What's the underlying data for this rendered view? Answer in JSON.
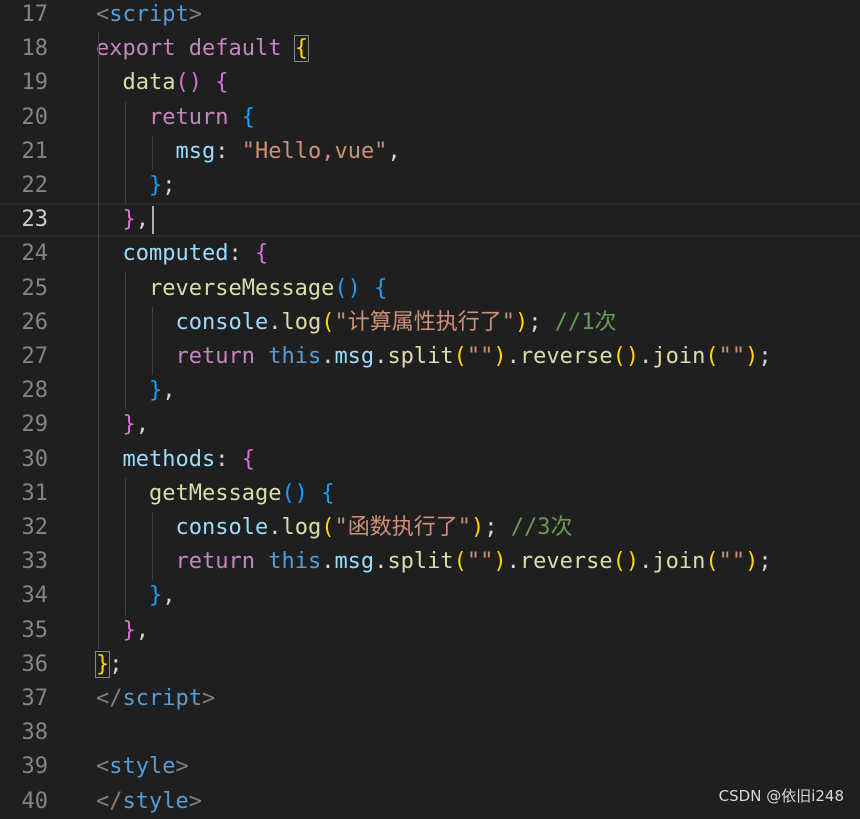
{
  "editor": {
    "lines": [
      {
        "num": "17",
        "tokens": [
          {
            "t": "<",
            "c": "tag-br"
          },
          {
            "t": "script",
            "c": "tag"
          },
          {
            "t": ">",
            "c": "tag-br"
          }
        ]
      },
      {
        "num": "18",
        "tokens": [
          {
            "t": "export ",
            "c": "kw"
          },
          {
            "t": "default ",
            "c": "kw"
          },
          {
            "t": "{",
            "c": "b1 match"
          }
        ]
      },
      {
        "num": "19",
        "tokens": [
          {
            "t": "  "
          },
          {
            "t": "data",
            "c": "fn"
          },
          {
            "t": "()",
            "c": "b2"
          },
          {
            "t": " "
          },
          {
            "t": "{",
            "c": "b2"
          }
        ]
      },
      {
        "num": "20",
        "tokens": [
          {
            "t": "    "
          },
          {
            "t": "return ",
            "c": "kw"
          },
          {
            "t": "{",
            "c": "b3"
          }
        ]
      },
      {
        "num": "21",
        "tokens": [
          {
            "t": "      "
          },
          {
            "t": "msg",
            "c": "prop"
          },
          {
            "t": ": ",
            "c": "punc"
          },
          {
            "t": "\"Hello,vue\"",
            "c": "str"
          },
          {
            "t": ",",
            "c": "punc"
          }
        ]
      },
      {
        "num": "22",
        "tokens": [
          {
            "t": "    "
          },
          {
            "t": "}",
            "c": "b3"
          },
          {
            "t": ";",
            "c": "punc"
          }
        ]
      },
      {
        "num": "23",
        "tokens": [
          {
            "t": "  "
          },
          {
            "t": "}",
            "c": "b2"
          },
          {
            "t": ",",
            "c": "punc"
          }
        ],
        "current": true
      },
      {
        "num": "24",
        "tokens": [
          {
            "t": "  "
          },
          {
            "t": "computed",
            "c": "prop"
          },
          {
            "t": ": ",
            "c": "punc"
          },
          {
            "t": "{",
            "c": "b2"
          }
        ]
      },
      {
        "num": "25",
        "tokens": [
          {
            "t": "    "
          },
          {
            "t": "reverseMessage",
            "c": "fn"
          },
          {
            "t": "()",
            "c": "b3"
          },
          {
            "t": " "
          },
          {
            "t": "{",
            "c": "b3"
          }
        ]
      },
      {
        "num": "26",
        "tokens": [
          {
            "t": "      "
          },
          {
            "t": "console",
            "c": "var"
          },
          {
            "t": ".",
            "c": "punc"
          },
          {
            "t": "log",
            "c": "fn"
          },
          {
            "t": "(",
            "c": "b1"
          },
          {
            "t": "\"计算属性执行了\"",
            "c": "str"
          },
          {
            "t": ")",
            "c": "b1"
          },
          {
            "t": "; ",
            "c": "punc"
          },
          {
            "t": "//1次",
            "c": "cmt"
          }
        ]
      },
      {
        "num": "27",
        "tokens": [
          {
            "t": "      "
          },
          {
            "t": "return ",
            "c": "kw"
          },
          {
            "t": "this",
            "c": "this"
          },
          {
            "t": ".",
            "c": "punc"
          },
          {
            "t": "msg",
            "c": "var"
          },
          {
            "t": ".",
            "c": "punc"
          },
          {
            "t": "split",
            "c": "fn"
          },
          {
            "t": "(",
            "c": "b1"
          },
          {
            "t": "\"\"",
            "c": "str"
          },
          {
            "t": ")",
            "c": "b1"
          },
          {
            "t": ".",
            "c": "punc"
          },
          {
            "t": "reverse",
            "c": "fn"
          },
          {
            "t": "()",
            "c": "b1"
          },
          {
            "t": ".",
            "c": "punc"
          },
          {
            "t": "join",
            "c": "fn"
          },
          {
            "t": "(",
            "c": "b1"
          },
          {
            "t": "\"\"",
            "c": "str"
          },
          {
            "t": ")",
            "c": "b1"
          },
          {
            "t": ";",
            "c": "punc"
          }
        ]
      },
      {
        "num": "28",
        "tokens": [
          {
            "t": "    "
          },
          {
            "t": "}",
            "c": "b3"
          },
          {
            "t": ",",
            "c": "punc"
          }
        ]
      },
      {
        "num": "29",
        "tokens": [
          {
            "t": "  "
          },
          {
            "t": "}",
            "c": "b2"
          },
          {
            "t": ",",
            "c": "punc"
          }
        ]
      },
      {
        "num": "30",
        "tokens": [
          {
            "t": "  "
          },
          {
            "t": "methods",
            "c": "prop"
          },
          {
            "t": ": ",
            "c": "punc"
          },
          {
            "t": "{",
            "c": "b2"
          }
        ]
      },
      {
        "num": "31",
        "tokens": [
          {
            "t": "    "
          },
          {
            "t": "getMessage",
            "c": "fn"
          },
          {
            "t": "()",
            "c": "b3"
          },
          {
            "t": " "
          },
          {
            "t": "{",
            "c": "b3"
          }
        ]
      },
      {
        "num": "32",
        "tokens": [
          {
            "t": "      "
          },
          {
            "t": "console",
            "c": "var"
          },
          {
            "t": ".",
            "c": "punc"
          },
          {
            "t": "log",
            "c": "fn"
          },
          {
            "t": "(",
            "c": "b1"
          },
          {
            "t": "\"函数执行了\"",
            "c": "str"
          },
          {
            "t": ")",
            "c": "b1"
          },
          {
            "t": "; ",
            "c": "punc"
          },
          {
            "t": "//3次",
            "c": "cmt"
          }
        ]
      },
      {
        "num": "33",
        "tokens": [
          {
            "t": "      "
          },
          {
            "t": "return ",
            "c": "kw"
          },
          {
            "t": "this",
            "c": "this"
          },
          {
            "t": ".",
            "c": "punc"
          },
          {
            "t": "msg",
            "c": "var"
          },
          {
            "t": ".",
            "c": "punc"
          },
          {
            "t": "split",
            "c": "fn"
          },
          {
            "t": "(",
            "c": "b1"
          },
          {
            "t": "\"\"",
            "c": "str"
          },
          {
            "t": ")",
            "c": "b1"
          },
          {
            "t": ".",
            "c": "punc"
          },
          {
            "t": "reverse",
            "c": "fn"
          },
          {
            "t": "()",
            "c": "b1"
          },
          {
            "t": ".",
            "c": "punc"
          },
          {
            "t": "join",
            "c": "fn"
          },
          {
            "t": "(",
            "c": "b1"
          },
          {
            "t": "\"\"",
            "c": "str"
          },
          {
            "t": ")",
            "c": "b1"
          },
          {
            "t": ";",
            "c": "punc"
          }
        ]
      },
      {
        "num": "34",
        "tokens": [
          {
            "t": "    "
          },
          {
            "t": "}",
            "c": "b3"
          },
          {
            "t": ",",
            "c": "punc"
          }
        ]
      },
      {
        "num": "35",
        "tokens": [
          {
            "t": "  "
          },
          {
            "t": "}",
            "c": "b2"
          },
          {
            "t": ",",
            "c": "punc"
          }
        ]
      },
      {
        "num": "36",
        "tokens": [
          {
            "t": "}",
            "c": "b1 match"
          },
          {
            "t": ";",
            "c": "punc"
          }
        ]
      },
      {
        "num": "37",
        "tokens": [
          {
            "t": "</",
            "c": "tag-br"
          },
          {
            "t": "script",
            "c": "tag"
          },
          {
            "t": ">",
            "c": "tag-br"
          }
        ]
      },
      {
        "num": "38",
        "tokens": []
      },
      {
        "num": "39",
        "tokens": [
          {
            "t": "<",
            "c": "tag-br"
          },
          {
            "t": "style",
            "c": "tag"
          },
          {
            "t": ">",
            "c": "tag-br"
          }
        ]
      },
      {
        "num": "40",
        "tokens": [
          {
            "t": "</",
            "c": "tag-br"
          },
          {
            "t": "style",
            "c": "tag"
          },
          {
            "t": ">",
            "c": "tag-br"
          }
        ]
      }
    ]
  },
  "watermark": "CSDN @依旧i248"
}
